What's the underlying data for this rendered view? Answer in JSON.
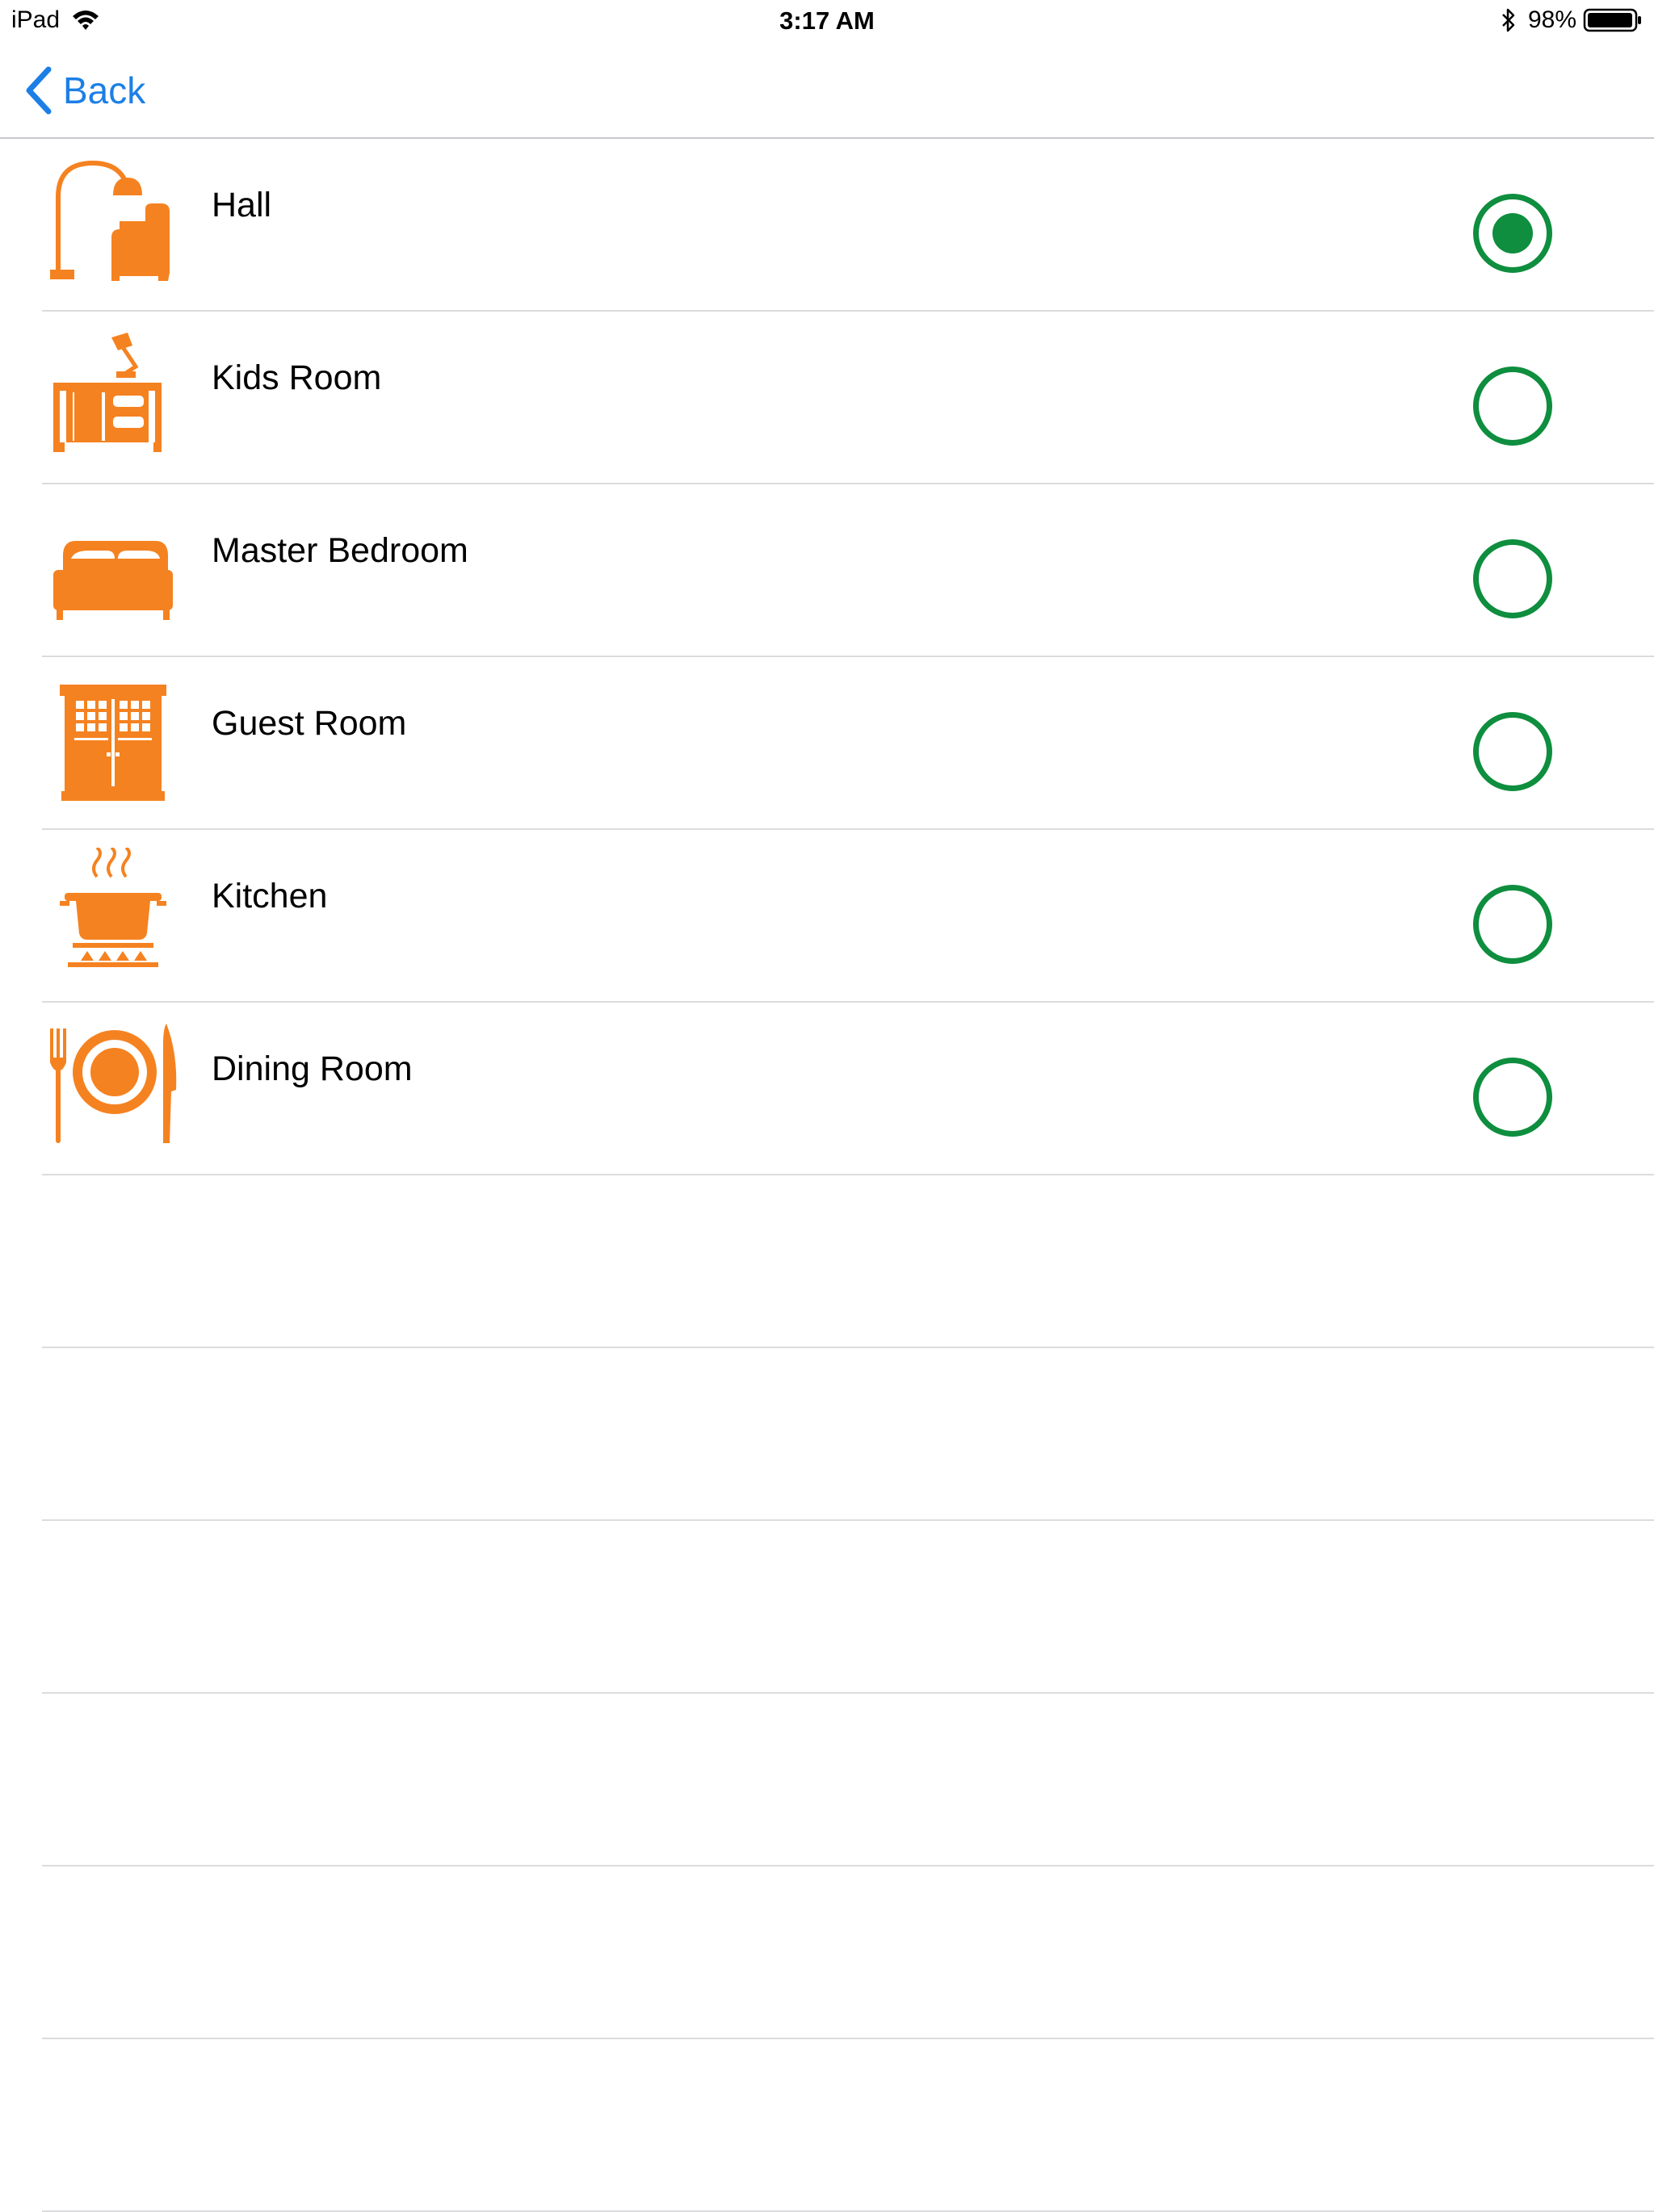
{
  "status_bar": {
    "device": "iPad",
    "time": "3:17 AM",
    "battery": "98%"
  },
  "nav": {
    "back_label": "Back"
  },
  "colors": {
    "accent": "#1c7fe6",
    "icon": "#f58220",
    "radio": "#0e8e3e",
    "separator": "#dcdcdf"
  },
  "rooms": [
    {
      "label": "Hall",
      "icon": "floor-lamp-armchair-icon",
      "selected": true
    },
    {
      "label": "Kids Room",
      "icon": "desk-lamp-icon",
      "selected": false
    },
    {
      "label": "Master Bedroom",
      "icon": "bed-icon",
      "selected": false
    },
    {
      "label": "Guest Room",
      "icon": "wardrobe-icon",
      "selected": false
    },
    {
      "label": "Kitchen",
      "icon": "cooking-pot-icon",
      "selected": false
    },
    {
      "label": "Dining Room",
      "icon": "plate-cutlery-icon",
      "selected": false
    }
  ]
}
